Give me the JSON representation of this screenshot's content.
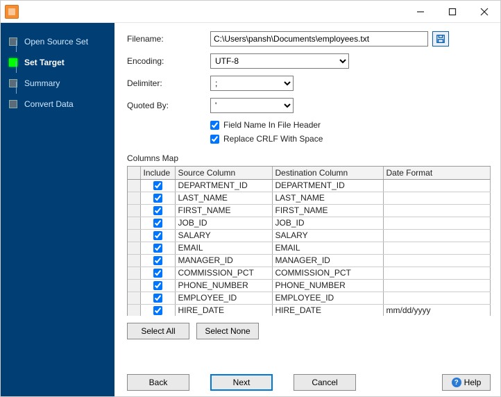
{
  "sidebar": {
    "steps": [
      {
        "label": "Open Source Set",
        "active": false
      },
      {
        "label": "Set Target",
        "active": true
      },
      {
        "label": "Summary",
        "active": false
      },
      {
        "label": "Convert Data",
        "active": false
      }
    ]
  },
  "form": {
    "filename_label": "Filename:",
    "filename_value": "C:\\Users\\pansh\\Documents\\employees.txt",
    "encoding_label": "Encoding:",
    "encoding_value": "UTF-8",
    "delimiter_label": "Delimiter:",
    "delimiter_value": ";",
    "quoted_label": "Quoted By:",
    "quoted_value": "'",
    "chk_header_label": "Field Name In File Header",
    "chk_header_checked": true,
    "chk_crlf_label": "Replace CRLF With Space",
    "chk_crlf_checked": true
  },
  "columns_map_label": "Columns Map",
  "grid": {
    "headers": {
      "include": "Include",
      "source": "Source Column",
      "dest": "Destination Column",
      "datefmt": "Date Format"
    },
    "rows": [
      {
        "include": true,
        "source": "DEPARTMENT_ID",
        "dest": "DEPARTMENT_ID",
        "datefmt": ""
      },
      {
        "include": true,
        "source": "LAST_NAME",
        "dest": "LAST_NAME",
        "datefmt": ""
      },
      {
        "include": true,
        "source": "FIRST_NAME",
        "dest": "FIRST_NAME",
        "datefmt": ""
      },
      {
        "include": true,
        "source": "JOB_ID",
        "dest": "JOB_ID",
        "datefmt": ""
      },
      {
        "include": true,
        "source": "SALARY",
        "dest": "SALARY",
        "datefmt": ""
      },
      {
        "include": true,
        "source": "EMAIL",
        "dest": "EMAIL",
        "datefmt": ""
      },
      {
        "include": true,
        "source": "MANAGER_ID",
        "dest": "MANAGER_ID",
        "datefmt": ""
      },
      {
        "include": true,
        "source": "COMMISSION_PCT",
        "dest": "COMMISSION_PCT",
        "datefmt": ""
      },
      {
        "include": true,
        "source": "PHONE_NUMBER",
        "dest": "PHONE_NUMBER",
        "datefmt": ""
      },
      {
        "include": true,
        "source": "EMPLOYEE_ID",
        "dest": "EMPLOYEE_ID",
        "datefmt": ""
      },
      {
        "include": true,
        "source": "HIRE_DATE",
        "dest": "HIRE_DATE",
        "datefmt": "mm/dd/yyyy"
      }
    ]
  },
  "buttons": {
    "select_all": "Select All",
    "select_none": "Select None",
    "back": "Back",
    "next": "Next",
    "cancel": "Cancel",
    "help": "Help"
  }
}
